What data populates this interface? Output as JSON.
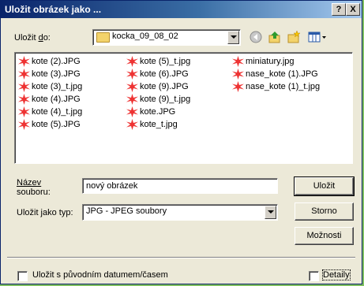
{
  "window": {
    "title": "Uložit obrázek jako ...",
    "help_label": "?",
    "close_label": "X"
  },
  "location": {
    "label_prefix": "Uložit ",
    "label_key": "d",
    "label_suffix": "o:",
    "folder": "kocka_09_08_02"
  },
  "files": {
    "col1": [
      "kote (2).JPG",
      "kote (3).JPG",
      "kote (3)_t.jpg",
      "kote (4).JPG",
      "kote (4)_t.jpg",
      "kote (5).JPG"
    ],
    "col2": [
      "kote (5)_t.jpg",
      "kote (6).JPG",
      "kote (9).JPG",
      "kote (9)_t.jpg",
      "kote.JPG",
      "kote_t.jpg"
    ],
    "col3": [
      "miniatury.jpg",
      "nase_kote (1).JPG",
      "nase_kote (1)_t.jpg"
    ]
  },
  "filename": {
    "label_line1": "Název",
    "label_line2": "souboru:",
    "value": "nový obrázek"
  },
  "filetype": {
    "label": "Uložit jako typ:",
    "value": "JPG - JPEG soubory"
  },
  "buttons": {
    "save": "Uložit",
    "cancel": "Storno",
    "options": "Možnosti"
  },
  "footer": {
    "keep_date_label": "Uložit s původním datumem/časem",
    "details_label": "Detaily"
  }
}
